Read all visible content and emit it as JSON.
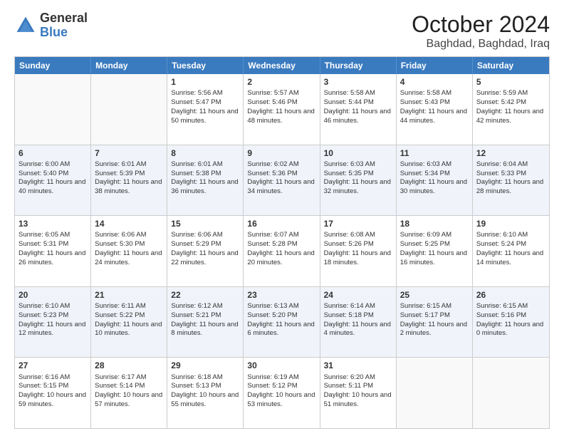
{
  "header": {
    "logo_general": "General",
    "logo_blue": "Blue",
    "month_title": "October 2024",
    "location": "Baghdad, Baghdad, Iraq"
  },
  "days_of_week": [
    "Sunday",
    "Monday",
    "Tuesday",
    "Wednesday",
    "Thursday",
    "Friday",
    "Saturday"
  ],
  "rows": [
    [
      {
        "day": "",
        "sunrise": "",
        "sunset": "",
        "daylight": ""
      },
      {
        "day": "",
        "sunrise": "",
        "sunset": "",
        "daylight": ""
      },
      {
        "day": "1",
        "sunrise": "Sunrise: 5:56 AM",
        "sunset": "Sunset: 5:47 PM",
        "daylight": "Daylight: 11 hours and 50 minutes."
      },
      {
        "day": "2",
        "sunrise": "Sunrise: 5:57 AM",
        "sunset": "Sunset: 5:46 PM",
        "daylight": "Daylight: 11 hours and 48 minutes."
      },
      {
        "day": "3",
        "sunrise": "Sunrise: 5:58 AM",
        "sunset": "Sunset: 5:44 PM",
        "daylight": "Daylight: 11 hours and 46 minutes."
      },
      {
        "day": "4",
        "sunrise": "Sunrise: 5:58 AM",
        "sunset": "Sunset: 5:43 PM",
        "daylight": "Daylight: 11 hours and 44 minutes."
      },
      {
        "day": "5",
        "sunrise": "Sunrise: 5:59 AM",
        "sunset": "Sunset: 5:42 PM",
        "daylight": "Daylight: 11 hours and 42 minutes."
      }
    ],
    [
      {
        "day": "6",
        "sunrise": "Sunrise: 6:00 AM",
        "sunset": "Sunset: 5:40 PM",
        "daylight": "Daylight: 11 hours and 40 minutes."
      },
      {
        "day": "7",
        "sunrise": "Sunrise: 6:01 AM",
        "sunset": "Sunset: 5:39 PM",
        "daylight": "Daylight: 11 hours and 38 minutes."
      },
      {
        "day": "8",
        "sunrise": "Sunrise: 6:01 AM",
        "sunset": "Sunset: 5:38 PM",
        "daylight": "Daylight: 11 hours and 36 minutes."
      },
      {
        "day": "9",
        "sunrise": "Sunrise: 6:02 AM",
        "sunset": "Sunset: 5:36 PM",
        "daylight": "Daylight: 11 hours and 34 minutes."
      },
      {
        "day": "10",
        "sunrise": "Sunrise: 6:03 AM",
        "sunset": "Sunset: 5:35 PM",
        "daylight": "Daylight: 11 hours and 32 minutes."
      },
      {
        "day": "11",
        "sunrise": "Sunrise: 6:03 AM",
        "sunset": "Sunset: 5:34 PM",
        "daylight": "Daylight: 11 hours and 30 minutes."
      },
      {
        "day": "12",
        "sunrise": "Sunrise: 6:04 AM",
        "sunset": "Sunset: 5:33 PM",
        "daylight": "Daylight: 11 hours and 28 minutes."
      }
    ],
    [
      {
        "day": "13",
        "sunrise": "Sunrise: 6:05 AM",
        "sunset": "Sunset: 5:31 PM",
        "daylight": "Daylight: 11 hours and 26 minutes."
      },
      {
        "day": "14",
        "sunrise": "Sunrise: 6:06 AM",
        "sunset": "Sunset: 5:30 PM",
        "daylight": "Daylight: 11 hours and 24 minutes."
      },
      {
        "day": "15",
        "sunrise": "Sunrise: 6:06 AM",
        "sunset": "Sunset: 5:29 PM",
        "daylight": "Daylight: 11 hours and 22 minutes."
      },
      {
        "day": "16",
        "sunrise": "Sunrise: 6:07 AM",
        "sunset": "Sunset: 5:28 PM",
        "daylight": "Daylight: 11 hours and 20 minutes."
      },
      {
        "day": "17",
        "sunrise": "Sunrise: 6:08 AM",
        "sunset": "Sunset: 5:26 PM",
        "daylight": "Daylight: 11 hours and 18 minutes."
      },
      {
        "day": "18",
        "sunrise": "Sunrise: 6:09 AM",
        "sunset": "Sunset: 5:25 PM",
        "daylight": "Daylight: 11 hours and 16 minutes."
      },
      {
        "day": "19",
        "sunrise": "Sunrise: 6:10 AM",
        "sunset": "Sunset: 5:24 PM",
        "daylight": "Daylight: 11 hours and 14 minutes."
      }
    ],
    [
      {
        "day": "20",
        "sunrise": "Sunrise: 6:10 AM",
        "sunset": "Sunset: 5:23 PM",
        "daylight": "Daylight: 11 hours and 12 minutes."
      },
      {
        "day": "21",
        "sunrise": "Sunrise: 6:11 AM",
        "sunset": "Sunset: 5:22 PM",
        "daylight": "Daylight: 11 hours and 10 minutes."
      },
      {
        "day": "22",
        "sunrise": "Sunrise: 6:12 AM",
        "sunset": "Sunset: 5:21 PM",
        "daylight": "Daylight: 11 hours and 8 minutes."
      },
      {
        "day": "23",
        "sunrise": "Sunrise: 6:13 AM",
        "sunset": "Sunset: 5:20 PM",
        "daylight": "Daylight: 11 hours and 6 minutes."
      },
      {
        "day": "24",
        "sunrise": "Sunrise: 6:14 AM",
        "sunset": "Sunset: 5:18 PM",
        "daylight": "Daylight: 11 hours and 4 minutes."
      },
      {
        "day": "25",
        "sunrise": "Sunrise: 6:15 AM",
        "sunset": "Sunset: 5:17 PM",
        "daylight": "Daylight: 11 hours and 2 minutes."
      },
      {
        "day": "26",
        "sunrise": "Sunrise: 6:15 AM",
        "sunset": "Sunset: 5:16 PM",
        "daylight": "Daylight: 11 hours and 0 minutes."
      }
    ],
    [
      {
        "day": "27",
        "sunrise": "Sunrise: 6:16 AM",
        "sunset": "Sunset: 5:15 PM",
        "daylight": "Daylight: 10 hours and 59 minutes."
      },
      {
        "day": "28",
        "sunrise": "Sunrise: 6:17 AM",
        "sunset": "Sunset: 5:14 PM",
        "daylight": "Daylight: 10 hours and 57 minutes."
      },
      {
        "day": "29",
        "sunrise": "Sunrise: 6:18 AM",
        "sunset": "Sunset: 5:13 PM",
        "daylight": "Daylight: 10 hours and 55 minutes."
      },
      {
        "day": "30",
        "sunrise": "Sunrise: 6:19 AM",
        "sunset": "Sunset: 5:12 PM",
        "daylight": "Daylight: 10 hours and 53 minutes."
      },
      {
        "day": "31",
        "sunrise": "Sunrise: 6:20 AM",
        "sunset": "Sunset: 5:11 PM",
        "daylight": "Daylight: 10 hours and 51 minutes."
      },
      {
        "day": "",
        "sunrise": "",
        "sunset": "",
        "daylight": ""
      },
      {
        "day": "",
        "sunrise": "",
        "sunset": "",
        "daylight": ""
      }
    ]
  ]
}
